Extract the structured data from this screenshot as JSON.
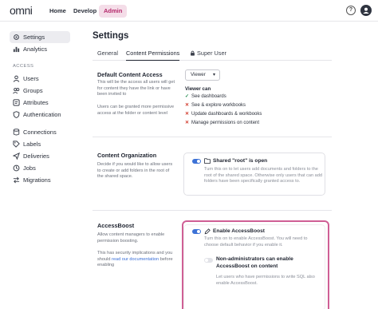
{
  "topbar": {
    "logo": "omni",
    "nav": [
      "Home",
      "Develop",
      "Admin"
    ],
    "help_label": "?"
  },
  "sidebar": {
    "items_top": [
      {
        "label": "Settings",
        "icon": "gear-icon"
      },
      {
        "label": "Analytics",
        "icon": "chart-icon"
      }
    ],
    "access_heading": "ACCESS",
    "items_access": [
      {
        "label": "Users",
        "icon": "user-icon"
      },
      {
        "label": "Groups",
        "icon": "group-icon"
      },
      {
        "label": "Attributes",
        "icon": "attributes-icon"
      },
      {
        "label": "Authentication",
        "icon": "shield-icon"
      }
    ],
    "items_other": [
      {
        "label": "Connections",
        "icon": "database-icon"
      },
      {
        "label": "Labels",
        "icon": "tag-icon"
      },
      {
        "label": "Deliveries",
        "icon": "send-icon"
      },
      {
        "label": "Jobs",
        "icon": "clock-icon"
      },
      {
        "label": "Migrations",
        "icon": "migrate-icon"
      }
    ]
  },
  "main": {
    "title": "Settings",
    "tabs": [
      "General",
      "Content Permissions",
      "Super User"
    ],
    "default_access": {
      "title": "Default Content Access",
      "desc1": "This will be the access all users will get for content they have the link or have been invited to",
      "desc2": "Users can be granted more permissive access at the folder or content level",
      "select_value": "Viewer",
      "viewer_can_title": "Viewer can",
      "permissions": [
        {
          "ok": true,
          "label": "See dashboards"
        },
        {
          "ok": false,
          "label": "See & explore workbooks"
        },
        {
          "ok": false,
          "label": "Update dashboards & workbooks"
        },
        {
          "ok": false,
          "label": "Manage permissions on content"
        }
      ]
    },
    "content_org": {
      "title": "Content Organization",
      "desc": "Decide if you would like to allow users to create or add folders in the root of the shared space.",
      "option_title": "Shared \"root\" is open",
      "option_desc": "Turn this on to let users add documents and folders to the root of the shared space. Otherwise only users that can add folders have been specifically granted access to."
    },
    "accessboost": {
      "title": "AccessBoost",
      "desc1": "Allow content managers to enable permission boosting.",
      "desc2_pre": "This has security implications and you should ",
      "desc2_link": "read our documentation",
      "desc2_post": " before enabling",
      "option_title": "Enable AccessBoost",
      "option_desc": "Turn this on to enable AccessBoost. You will need to choose default behavior if you enable it.",
      "sub_option_title": "Non-administrators can enable AccessBoost on content",
      "sub_option_desc": "Let users who have permissions to write SQL also enable AccessBoost."
    }
  },
  "colors": {
    "accent": "#3d72d6",
    "admin_active_bg": "#f4dde8",
    "admin_active_text": "#b4286b",
    "highlight_border": "#cf5f95"
  }
}
